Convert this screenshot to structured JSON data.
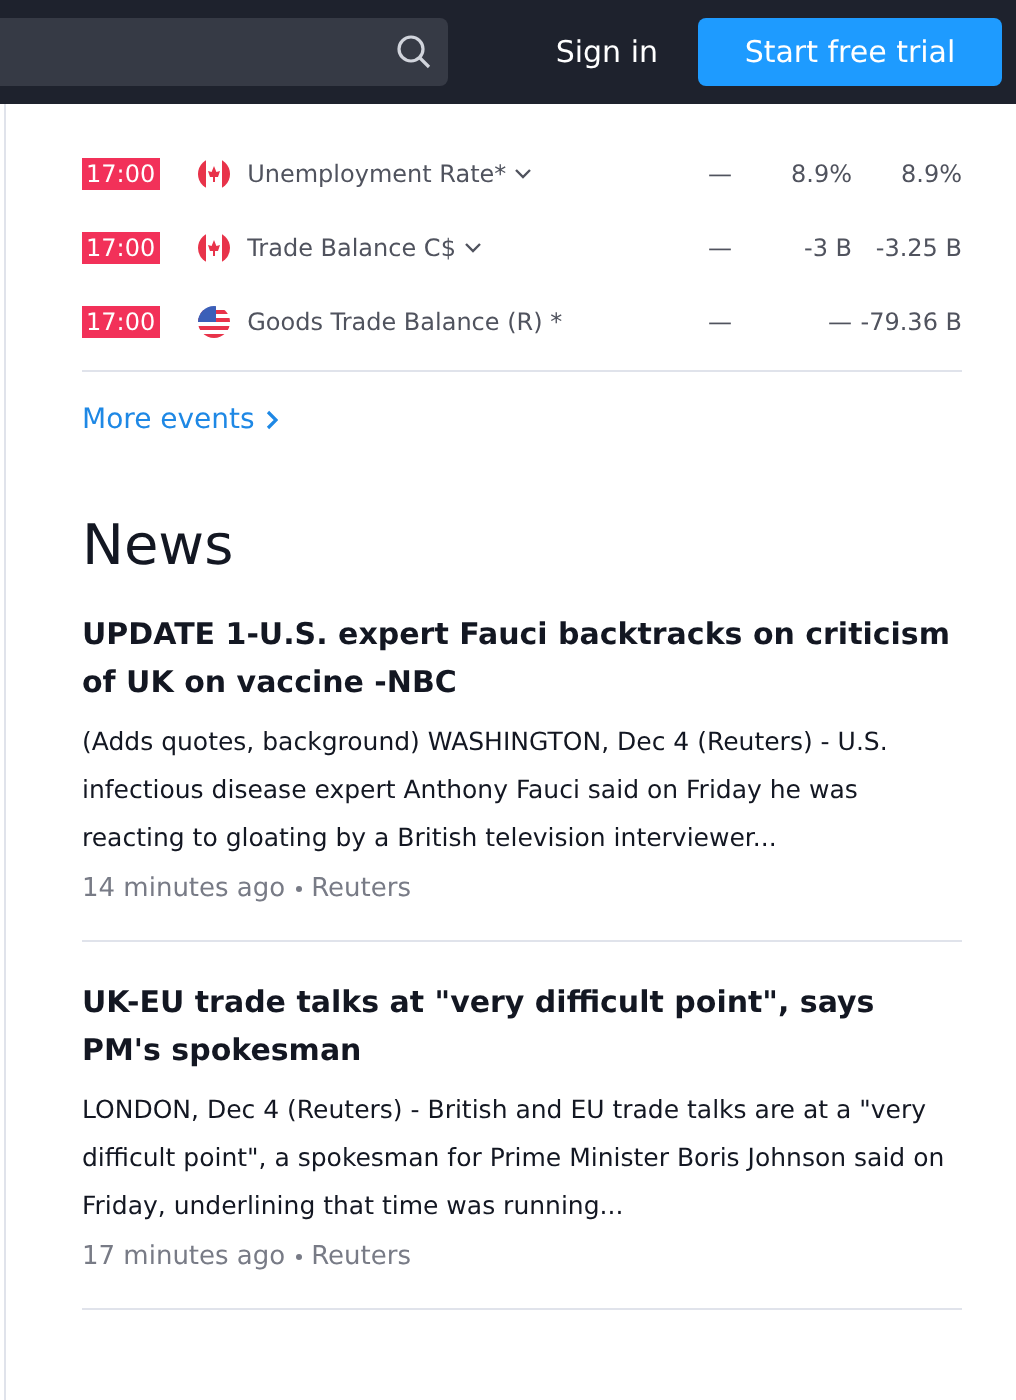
{
  "header": {
    "sign_in": "Sign in",
    "trial_button": "Start free trial"
  },
  "events": [
    {
      "time": "17:00",
      "kind": "ca",
      "name": "Unemployment Rate*",
      "expandable": true,
      "actual": "—",
      "forecast": "8.9%",
      "prior": "8.9%"
    },
    {
      "time": "17:00",
      "kind": "ca",
      "name": "Trade Balance C$",
      "expandable": true,
      "actual": "—",
      "forecast": "-3 B",
      "prior": "-3.25 B"
    },
    {
      "time": "17:00",
      "kind": "us",
      "name": "Goods Trade Balance (R) *",
      "expandable": false,
      "actual": "—",
      "forecast": "—",
      "prior": "-79.36 B"
    }
  ],
  "more_events": "More events",
  "news": {
    "title": "News",
    "items": [
      {
        "headline": "UPDATE 1-U.S. expert Fauci backtracks on criticism of UK on vaccine -NBC",
        "summary": "(Adds quotes, background) WASHINGTON, Dec 4 (Reuters) - U.S. infectious disease expert Anthony Fauci said on Friday he was reacting to gloating by a British television interviewer...",
        "time": "14 minutes ago",
        "source": "Reuters"
      },
      {
        "headline": "UK-EU trade talks at \"very difficult point\", says PM's spokesman",
        "summary": "LONDON, Dec 4 (Reuters) - British and EU trade talks are at a \"very difficult point\", a spokesman for Prime Minister Boris Johnson said on Friday, underlining that time was running...",
        "time": "17 minutes ago",
        "source": "Reuters"
      }
    ]
  }
}
